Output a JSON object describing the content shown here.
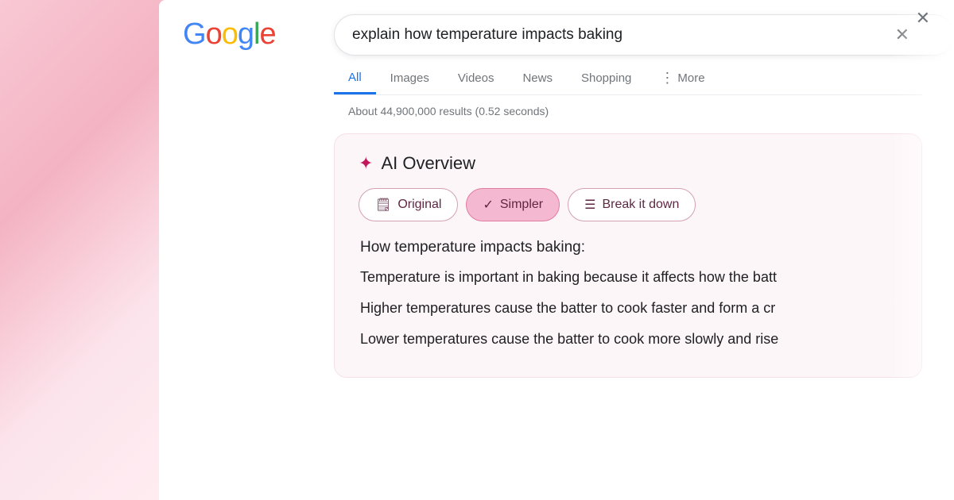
{
  "logo": {
    "g1": "G",
    "o1": "o",
    "o2": "o",
    "g2": "g",
    "l": "l",
    "e": "e",
    "full": "Google"
  },
  "search": {
    "query": "explain how temperature impacts baking",
    "placeholder": "explain how temperature impacts baking"
  },
  "nav": {
    "tabs": [
      {
        "id": "all",
        "label": "All",
        "active": true
      },
      {
        "id": "images",
        "label": "Images",
        "active": false
      },
      {
        "id": "videos",
        "label": "Videos",
        "active": false
      },
      {
        "id": "news",
        "label": "News",
        "active": false
      },
      {
        "id": "shopping",
        "label": "Shopping",
        "active": false
      }
    ],
    "more_label": "More",
    "more_icon": "⋮"
  },
  "results_count": "About 44,900,000 results (0.52 seconds)",
  "ai_overview": {
    "title": "AI Overview",
    "star_icon": "✦",
    "mode_buttons": [
      {
        "id": "original",
        "label": "Original",
        "icon": "🗒",
        "active": false
      },
      {
        "id": "simpler",
        "label": "Simpler",
        "icon": "✓",
        "active": true
      },
      {
        "id": "break_it_down",
        "label": "Break it down",
        "icon": "☰",
        "active": false
      }
    ],
    "content_title": "How temperature impacts baking:",
    "content_lines": [
      "Temperature is important in baking because it affects how the batt",
      "Higher temperatures cause the batter to cook faster and form a cr",
      "Lower temperatures cause the batter to cook more slowly and rise"
    ]
  }
}
